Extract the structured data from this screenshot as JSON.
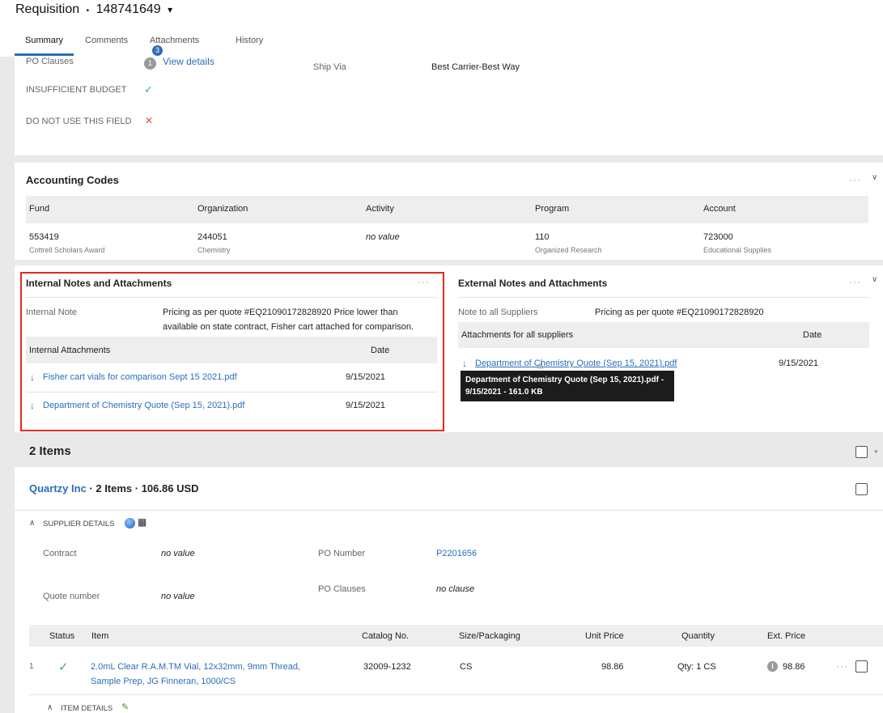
{
  "header": {
    "title": "Requisition",
    "separator": "•",
    "number": "148741649",
    "caret": "▾"
  },
  "tabs": [
    {
      "label": "Summary"
    },
    {
      "label": "Comments"
    },
    {
      "label": "Attachments",
      "badge": "3"
    },
    {
      "label": "History"
    }
  ],
  "top_section": {
    "po_clauses_label": "PO Clauses",
    "po_clauses_count": "1",
    "view_details": "View details",
    "ship_via_label": "Ship Via",
    "ship_via_value": "Best Carrier-Best Way",
    "insufficient_budget_label": "INSUFFICIENT BUDGET",
    "insufficient_budget_mark": "✓",
    "do_not_use_label": "DO NOT USE THIS FIELD",
    "do_not_use_mark": "✕"
  },
  "accounting": {
    "title": "Accounting Codes",
    "columns": [
      "Fund",
      "Organization",
      "Activity",
      "Program",
      "Account"
    ],
    "values": [
      {
        "value": "553419",
        "sub": "Cottrell Scholars Award"
      },
      {
        "value": "244051",
        "sub": "Chemistry"
      },
      {
        "value": "no value",
        "sub": ""
      },
      {
        "value": "110",
        "sub": "Organized Research"
      },
      {
        "value": "723000",
        "sub": "Educational Supplies"
      }
    ]
  },
  "internal_notes": {
    "title": "Internal Notes and Attachments",
    "note_label": "Internal Note",
    "note_line1": "Pricing as per quote #EQ21090172828920 Price lower than",
    "note_line2": "available on state contract, Fisher cart attached for comparison.",
    "attachments_label": "Internal Attachments",
    "date_label": "Date",
    "files": [
      {
        "name": "Fisher cart vials for comparison Sept 15 2021.pdf",
        "date": "9/15/2021"
      },
      {
        "name": "Department of Chemistry Quote (Sep 15, 2021).pdf",
        "date": "9/15/2021"
      }
    ]
  },
  "external_notes": {
    "title": "External Notes and Attachments",
    "note_label": "Note to all Suppliers",
    "note_value": "Pricing as per quote #EQ21090172828920",
    "attachments_label": "Attachments for all suppliers",
    "date_label": "Date",
    "file_name": "Department of Chemistry Quote (Sep 15, 2021).pdf",
    "file_date": "9/15/2021",
    "tooltip_line1": "Department of Chemistry Quote (Sep 15, 2021).pdf -",
    "tooltip_line2": "9/15/2021 - 161.0 KB"
  },
  "items": {
    "title": "2 Items",
    "supplier_name": "Quartzy Inc",
    "supplier_summary": " · 2 Items · 106.86 USD",
    "supplier_details_label": "SUPPLIER DETAILS",
    "contract_label": "Contract",
    "contract_value": "no value",
    "po_number_label": "PO Number",
    "po_number_value": "P2201656",
    "quote_label": "Quote number",
    "quote_value": "no value",
    "po_clauses_label": "PO Clauses",
    "po_clauses_value": "no clause",
    "columns": {
      "status": "Status",
      "item": "Item",
      "catalog": "Catalog No.",
      "size": "Size/Packaging",
      "unit_price": "Unit Price",
      "quantity": "Quantity",
      "ext_price": "Ext. Price"
    },
    "row": {
      "index": "1",
      "status_mark": "✓",
      "item_line1": "2.0mL Clear R.A.M.TM Vial, 12x32mm, 9mm Thread,",
      "item_line2": "Sample Prep, JG Finneran, 1000/CS",
      "catalog": "32009-1232",
      "size": "CS",
      "unit_price": "98.86",
      "quantity": "Qty: 1 CS",
      "ext_price": "98.86"
    },
    "item_details_label": "ITEM DETAILS"
  },
  "colors": {
    "link": "#2a6ebb",
    "highlight_box": "#e02b20",
    "check": "#3fae5a",
    "cross": "#e05050"
  }
}
